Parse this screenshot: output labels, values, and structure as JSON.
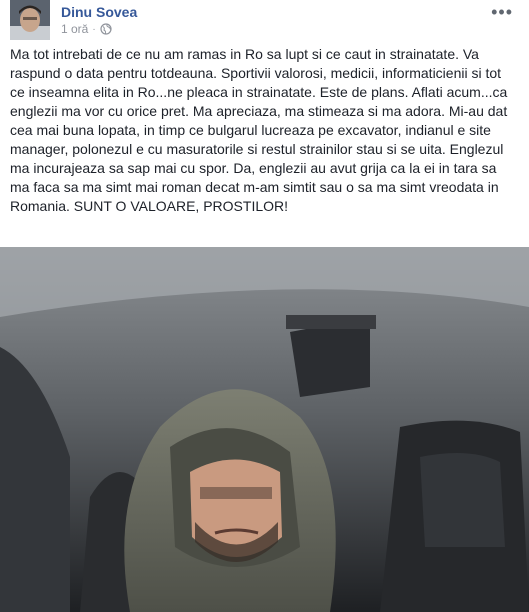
{
  "post": {
    "author": "Dinu Sovea",
    "time": "1 oră",
    "separator": "·",
    "privacy_icon": "globe-icon",
    "more_icon": "more-options-icon",
    "text": "Ma tot intrebati de ce nu am ramas in Ro sa lupt si ce caut in strainatate. Va raspund o data pentru totdeauna. Sportivii valorosi, medicii, informaticienii si tot ce inseamna elita in Ro...ne pleaca in strainatate. Este de plans. Aflati acum...ca englezii ma vor cu orice pret. Ma apreciaza, ma stimeaza si ma adora. Mi-au dat cea mai buna lopata, in timp ce bulgarul lucreaza pe excavator, indianul e site manager, polonezul e cu masuratorile si restul strainilor stau si se uita. Englezul ma incurajeaza sa sap mai cu spor. Da, englezii au avut grija ca la ei in tara sa ma faca sa ma simt mai roman decat m-am simtit sau o sa ma simt vreodata in Romania. SUNT O VALOARE, PROSTILOR!"
  },
  "colors": {
    "author_link": "#365899",
    "meta_text": "#90949c",
    "body_text": "#1d2129"
  }
}
